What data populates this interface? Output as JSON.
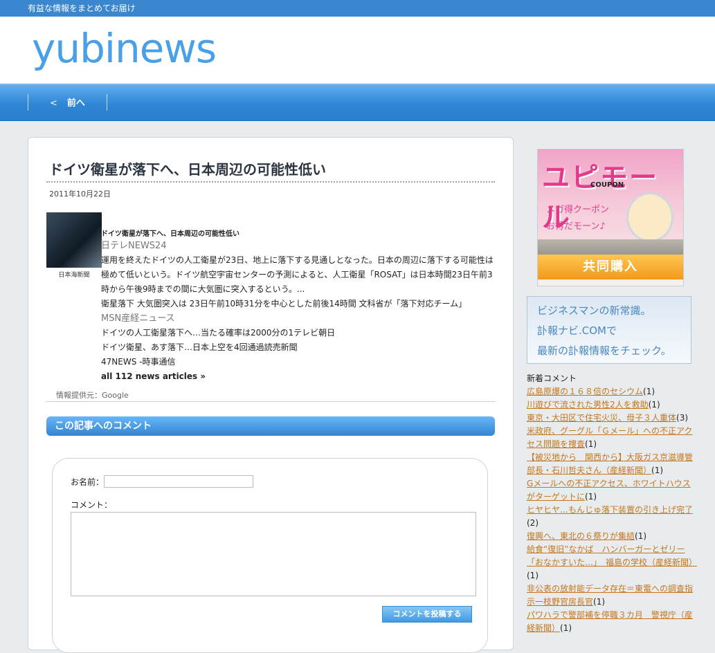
{
  "topbar": {
    "tagline": "有益な情報をまとめてお届け"
  },
  "header": {
    "logo": "yubinews"
  },
  "nav": {
    "prev_arrow": "<",
    "prev_label": "前へ"
  },
  "article": {
    "title": "ドイツ衛星が落下へ、日本周辺の可能性低い",
    "date": "2011年10月22日",
    "thumb_caption": "日本海新聞",
    "headline": "ドイツ衛星が落下へ、日本周辺の可能性低い",
    "source1": "日テレNEWS24",
    "body": "運用を終えたドイツの人工衛星が23日、地上に落下する見通しとなった。日本の周辺に落下する可能性は極めて低いという。ドイツ航空宇宙センターの予測によると、人工衛星「ROSAT」は日本時間23日午前3時から午後9時までの間に大気圏に突入するという。...",
    "related1": "衛星落下 大気圏突入は 23日午前10時31分を中心とした前後14時間 文科省が「落下対応チーム」",
    "related1_src": "MSN産経ニュース",
    "related2": "ドイツの人工衛星落下へ…当たる確率は2000分の1テレビ朝日",
    "related3": "ドイツ衛星、あす落下…日本上空を4回通過読売新聞",
    "related4": "47NEWS -時事通信",
    "all_link": "all 112 news articles »",
    "provider": "情報提供元：Google"
  },
  "comment_form": {
    "heading": "この記事へのコメント",
    "name_label": "お名前：",
    "comment_label": "コメント：",
    "submit_label": "コメントを投稿する"
  },
  "sidebar": {
    "banner1": {
      "brand": "ユピモール",
      "coupon": "COUPON",
      "line1": "メガ得クーポン",
      "line2": "お得だモーン♪",
      "ribbon": "共同購入"
    },
    "banner2": {
      "line1": "ビジネスマンの新常識。",
      "line2": "訃報ナビ.COMで",
      "line3": "最新の訃報情報をチェック。"
    },
    "new_comments_title": "新着コメント",
    "new_comments": [
      {
        "title": "広島原爆の１６８倍のセシウム",
        "count": "(1)"
      },
      {
        "title": "川遊びで流された男性2人を救助",
        "count": "(1)"
      },
      {
        "title": "東京・大田区で住宅火災、母子３人重体",
        "count": "(3)"
      },
      {
        "title": "米政府、グーグル「Ｇメール」への不正アクセス問題を捜査",
        "count": "(1)"
      },
      {
        "title": "【被災地から　関西から】大阪ガス京滋導管部長・石川哲夫さん（産経新聞）",
        "count": "(1)"
      },
      {
        "title": "Gメールへの不正アクセス、ホワイトハウスがターゲットに",
        "count": "(1)"
      },
      {
        "title": "ヒヤヒヤ…もんじゅ落下装置の引き上げ完了",
        "count": "(2)"
      },
      {
        "title": "復興へ、東北の６祭りが集結",
        "count": "(1)"
      },
      {
        "title": "給食“復旧”なかば　ハンバーガーとゼリー「おなかすいた…」　福島の学校（産経新聞）",
        "count": "(1)"
      },
      {
        "title": "非公表の放射能データ存在＝東電への調査指示一枝野官房長官",
        "count": "(1)"
      },
      {
        "title": "パワハラで警部補を停職３カ月　警視庁（産経新聞）",
        "count": "(1)"
      }
    ]
  }
}
